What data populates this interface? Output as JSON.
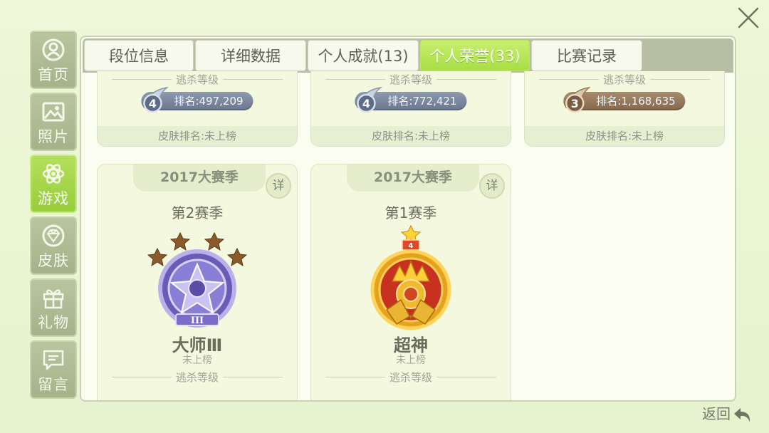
{
  "sidebar": {
    "items": [
      {
        "label": "首页",
        "icon": "home-icon",
        "active": false
      },
      {
        "label": "照片",
        "icon": "photo-icon",
        "active": false
      },
      {
        "label": "游戏",
        "icon": "atom-icon",
        "active": true
      },
      {
        "label": "皮肤",
        "icon": "diamond-icon",
        "active": false
      },
      {
        "label": "礼物",
        "icon": "gift-icon",
        "active": false
      },
      {
        "label": "留言",
        "icon": "message-icon",
        "active": false
      }
    ]
  },
  "tabs": [
    {
      "label": "段位信息"
    },
    {
      "label": "详细数据"
    },
    {
      "label": "个人成就(13)"
    },
    {
      "label": "个人荣誉(33)"
    },
    {
      "label": "比赛记录"
    }
  ],
  "top_cards": [
    {
      "kill_level_label": "逃杀等级",
      "level": "4",
      "rank_text": "排名:497,209",
      "skin_rank": "皮肤排名:未上榜"
    },
    {
      "kill_level_label": "逃杀等级",
      "level": "4",
      "rank_text": "排名:772,421",
      "skin_rank": "皮肤排名:未上榜"
    },
    {
      "kill_level_label": "逃杀等级",
      "level": "3",
      "rank_text": "排名:1,168,635",
      "skin_rank": "皮肤排名:未上榜"
    }
  ],
  "season_cards": [
    {
      "season": "2017大赛季",
      "detail_label": "详",
      "sub_season": "第2赛季",
      "tier": "大师Ⅲ",
      "status": "未上榜",
      "kill_level_label": "逃杀等级",
      "stars": 4,
      "emblem_numeral": "III"
    },
    {
      "season": "2017大赛季",
      "detail_label": "详",
      "sub_season": "第1赛季",
      "tier": "超神",
      "status": "未上榜",
      "kill_level_label": "逃杀等级",
      "stars": 1,
      "emblem_numeral": "4"
    }
  ],
  "back": {
    "label": "返回"
  },
  "colors": {
    "accent": "#a9de46",
    "pill_blue": "#7f8ca3",
    "pill_bronze": "#9b7a5c"
  }
}
